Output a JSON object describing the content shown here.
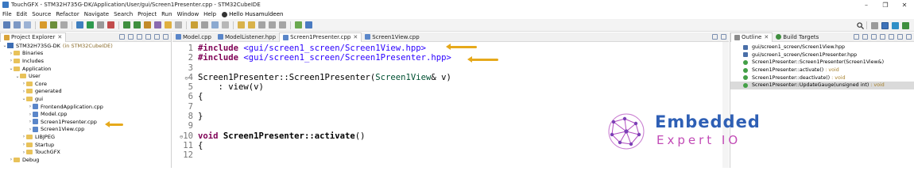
{
  "window": {
    "title": "TouchGFX - STM32H735G-DK/Application/User/gui/Screen1Presenter.cpp - STM32CubeIDE",
    "controls": [
      "–",
      "❐",
      "✕"
    ]
  },
  "menubar": {
    "items": [
      "File",
      "Edit",
      "Source",
      "Refactor",
      "Navigate",
      "Search",
      "Project",
      "Run",
      "Window",
      "Help"
    ],
    "user": "Hello Husamuldeen"
  },
  "explorer": {
    "tab_label": "Project Explorer",
    "close": "✕",
    "tree": [
      {
        "indent": 0,
        "twist": "⌄",
        "kind": "project",
        "label": "STM32H735G-DK",
        "decor": "(in STM32CubeIDE)"
      },
      {
        "indent": 1,
        "twist": "›",
        "kind": "folder",
        "label": "Binaries",
        "decor": ""
      },
      {
        "indent": 1,
        "twist": "›",
        "kind": "folder",
        "label": "Includes",
        "decor": ""
      },
      {
        "indent": 1,
        "twist": "⌄",
        "kind": "folder",
        "label": "Application",
        "decor": ""
      },
      {
        "indent": 2,
        "twist": "⌄",
        "kind": "folder",
        "label": "User",
        "decor": ""
      },
      {
        "indent": 3,
        "twist": "›",
        "kind": "folder",
        "label": "Core",
        "decor": ""
      },
      {
        "indent": 3,
        "twist": "›",
        "kind": "folder",
        "label": "generated",
        "decor": ""
      },
      {
        "indent": 3,
        "twist": "⌄",
        "kind": "folder",
        "label": "gui",
        "decor": ""
      },
      {
        "indent": 4,
        "twist": "›",
        "kind": "file",
        "label": "FrontendApplication.cpp",
        "decor": ""
      },
      {
        "indent": 4,
        "twist": "›",
        "kind": "file",
        "label": "Model.cpp",
        "decor": ""
      },
      {
        "indent": 4,
        "twist": "›",
        "kind": "file",
        "label": "Screen1Presenter.cpp",
        "decor": "",
        "selected": true
      },
      {
        "indent": 4,
        "twist": "›",
        "kind": "file",
        "label": "Screen1View.cpp",
        "decor": ""
      },
      {
        "indent": 3,
        "twist": "›",
        "kind": "folder",
        "label": "LIBJPEG",
        "decor": ""
      },
      {
        "indent": 3,
        "twist": "›",
        "kind": "folder",
        "label": "Startup",
        "decor": ""
      },
      {
        "indent": 3,
        "twist": "›",
        "kind": "folder",
        "label": "TouchGFX",
        "decor": ""
      },
      {
        "indent": 1,
        "twist": "›",
        "kind": "folder",
        "label": "Debug",
        "decor": ""
      }
    ]
  },
  "editor": {
    "tabs": [
      {
        "label": "Model.cpp",
        "active": false,
        "closable": false
      },
      {
        "label": "ModelListener.hpp",
        "active": false,
        "closable": false
      },
      {
        "label": "Screen1Presenter.cpp",
        "active": true,
        "closable": true
      },
      {
        "label": "Screen1View.cpp",
        "active": false,
        "closable": false
      }
    ],
    "lines": [
      {
        "n": "1",
        "marker": "",
        "tokens": [
          {
            "c": "kw",
            "t": "#include "
          },
          {
            "c": "inc",
            "t": "<gui/screen1_screen/Screen1View.hpp>"
          }
        ]
      },
      {
        "n": "2",
        "marker": "",
        "tokens": [
          {
            "c": "kw",
            "t": "#include "
          },
          {
            "c": "inc",
            "t": "<gui/screen1_screen/Screen1Presenter.hpp>"
          }
        ]
      },
      {
        "n": "3",
        "marker": "",
        "tokens": []
      },
      {
        "n": "4",
        "marker": "⊖",
        "tokens": [
          {
            "c": "normal",
            "t": "Screen1Presenter::Screen1Presenter("
          },
          {
            "c": "ty",
            "t": "Screen1View"
          },
          {
            "c": "normal",
            "t": "& v)"
          }
        ]
      },
      {
        "n": "5",
        "marker": "",
        "tokens": [
          {
            "c": "normal",
            "t": "    : view(v)"
          }
        ]
      },
      {
        "n": "6",
        "marker": "",
        "tokens": [
          {
            "c": "normal",
            "t": "{"
          }
        ]
      },
      {
        "n": "7",
        "marker": "",
        "tokens": []
      },
      {
        "n": "8",
        "marker": "",
        "tokens": [
          {
            "c": "normal",
            "t": "}"
          }
        ]
      },
      {
        "n": "9",
        "marker": "",
        "tokens": []
      },
      {
        "n": "10",
        "marker": "⊖",
        "tokens": [
          {
            "c": "kw",
            "t": "void "
          },
          {
            "c": "fn",
            "t": "Screen1Presenter::activate"
          },
          {
            "c": "normal",
            "t": "()"
          }
        ]
      },
      {
        "n": "11",
        "marker": "",
        "tokens": [
          {
            "c": "normal",
            "t": "{"
          }
        ]
      },
      {
        "n": "12",
        "marker": "",
        "tokens": []
      }
    ]
  },
  "outline": {
    "tabs": [
      {
        "label": "Outline",
        "active": true
      },
      {
        "label": "Build Targets",
        "active": false
      }
    ],
    "items": [
      {
        "kind": "inc",
        "label": "gui/screen1_screen/Screen1View.hpp",
        "ret": ""
      },
      {
        "kind": "inc",
        "label": "gui/screen1_screen/Screen1Presenter.hpp",
        "ret": ""
      },
      {
        "kind": "m",
        "label": "Screen1Presenter::Screen1Presenter(Screen1View&)",
        "ret": ""
      },
      {
        "kind": "m",
        "label": "Screen1Presenter::activate()",
        "ret": ": void"
      },
      {
        "kind": "m",
        "label": "Screen1Presenter::deactivate()",
        "ret": ": void"
      },
      {
        "kind": "m",
        "label": "Screen1Presenter::UpdateGauge(unsigned int)",
        "ret": ": void",
        "selected": true
      }
    ]
  },
  "logo": {
    "line1": "Embedded",
    "line2": "Expert IO"
  },
  "colors": {
    "accent": "#e6a91b",
    "keyword": "#7f0055",
    "string": "#2a00ff",
    "logo_blue": "#2e5fb5",
    "logo_pink": "#c24bb6"
  }
}
